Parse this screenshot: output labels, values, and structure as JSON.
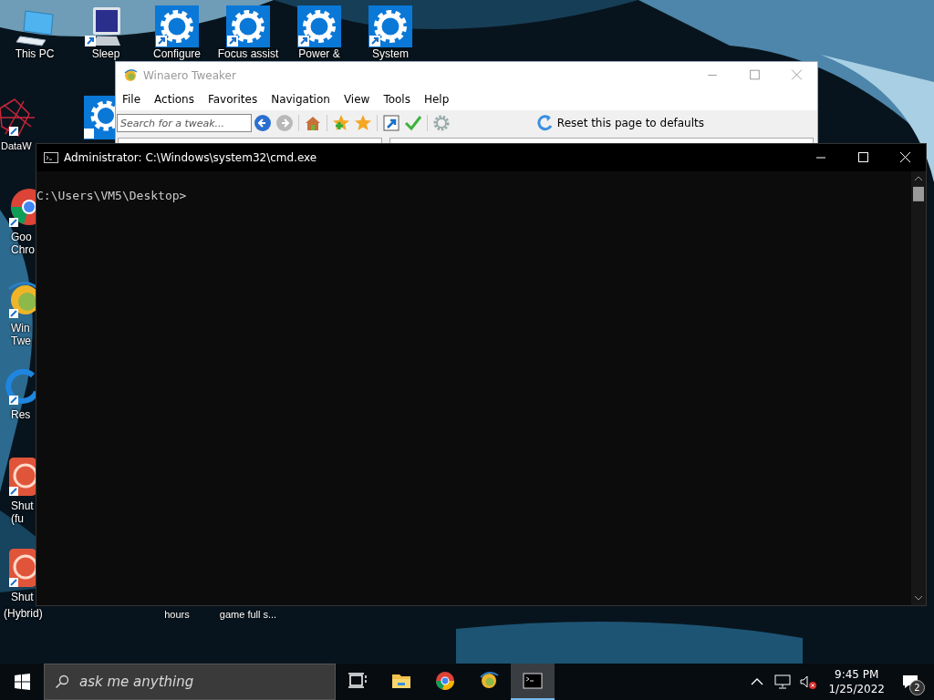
{
  "desktop": {
    "top_icons": [
      {
        "kind": "computer",
        "label": "This PC"
      },
      {
        "kind": "sleep",
        "label": "Sleep"
      },
      {
        "kind": "gear",
        "label": "Configure"
      },
      {
        "kind": "gear",
        "label": "Focus assist"
      },
      {
        "kind": "gear",
        "label": "Power &"
      },
      {
        "kind": "gear",
        "label": "System"
      }
    ],
    "left_icons": [
      {
        "kind": "web",
        "lines": [
          "DataW"
        ]
      },
      {
        "kind": "chrome",
        "lines": [
          "Goo",
          "Chro"
        ]
      },
      {
        "kind": "winaero",
        "lines": [
          "Win",
          "Twe"
        ]
      },
      {
        "kind": "restart",
        "lines": [
          "Res"
        ]
      },
      {
        "kind": "power",
        "lines": [
          "Shut",
          "(fu"
        ]
      },
      {
        "kind": "power",
        "lines": [
          "Shut",
          "(Hybrid)"
        ]
      }
    ],
    "partial_icons": [
      {
        "kind": "gear"
      }
    ],
    "bottom_labels": [
      "hours",
      "game full s..."
    ]
  },
  "winaero_window": {
    "title": "Winaero Tweaker",
    "menu": [
      "File",
      "Actions",
      "Favorites",
      "Navigation",
      "View",
      "Tools",
      "Help"
    ],
    "search": {
      "placeholder": "Search for a tweak..."
    },
    "toolbar": [
      {
        "kind": "back",
        "disabled": false
      },
      {
        "kind": "forward",
        "disabled": true
      },
      {
        "kind": "home"
      },
      {
        "kind": "add-favorite"
      },
      {
        "kind": "favorites"
      },
      {
        "kind": "shortcut"
      },
      {
        "kind": "apply"
      },
      {
        "kind": "settings"
      }
    ],
    "reset_button": "Reset this page to defaults"
  },
  "console_window": {
    "title": "Administrator: C:\\Windows\\system32\\cmd.exe",
    "prompt": "C:\\Users\\VM5\\Desktop>"
  },
  "taskbar": {
    "search": {
      "placeholder": "ask me anything"
    },
    "apps": [
      {
        "kind": "task-view",
        "selected": false
      },
      {
        "kind": "folder",
        "selected": false
      },
      {
        "kind": "chrome",
        "selected": false
      },
      {
        "kind": "winaero",
        "selected": false
      },
      {
        "kind": "console",
        "selected": true
      }
    ],
    "volume": {
      "muted": true
    },
    "clock": {
      "time": "9:45 PM",
      "date": "1/25/2022"
    },
    "notifications": "2"
  }
}
